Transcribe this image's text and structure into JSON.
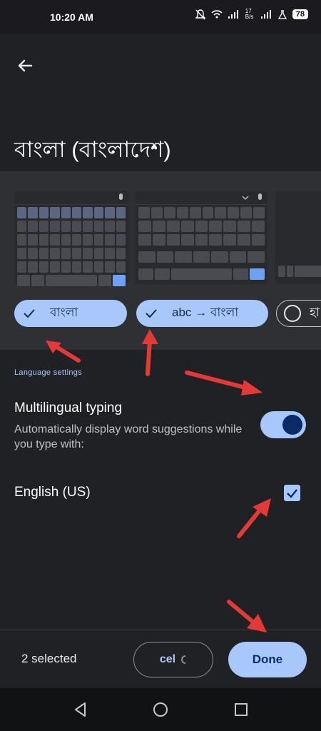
{
  "status_bar": {
    "time": "10:20 AM",
    "battery": "78",
    "network_speed": "17 B/s"
  },
  "header": {
    "back_icon": "arrow-back-icon",
    "title": "বাংলা (বাংলাদেশ)"
  },
  "layouts": [
    {
      "label": "বাংলা",
      "selected": true
    },
    {
      "label": "abc → বাংলা",
      "selected": true
    },
    {
      "label": "হা",
      "selected": false
    }
  ],
  "language_settings": {
    "section_label": "Language settings",
    "multilingual_title": "Multilingual typing",
    "multilingual_desc": "Automatically display word suggestions while you type with:",
    "multilingual_enabled": true,
    "languages": [
      {
        "label": "English (US)",
        "checked": true
      }
    ]
  },
  "footer": {
    "selected_count": "2 selected",
    "cancel_label": "cel",
    "done_label": "Done"
  },
  "colors": {
    "background": "#202124",
    "accent": "#a8c7fa",
    "annotation_arrow": "#e53935"
  }
}
